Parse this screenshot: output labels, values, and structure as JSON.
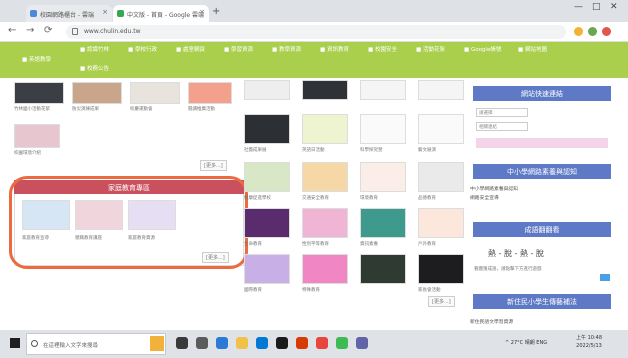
{
  "browser": {
    "tabs": [
      {
        "label": "校園網路櫃台 - 雲端",
        "close": "×"
      },
      {
        "label": "中文版 - 首頁 - Google 雲端",
        "close": "×"
      }
    ],
    "new_tab": "+",
    "window_buttons": [
      "—",
      "□",
      "✕"
    ],
    "nav": {
      "back": "←",
      "forward": "→",
      "reload": "⟳"
    },
    "url": "www.chulin.edu.tw"
  },
  "site_nav": {
    "items": [
      "■ 認識竹林",
      "■ 學校行政",
      "■ 處室網頁",
      "■ 學習資源",
      "■ 教學資源",
      "■ 資訊教育",
      "■ 校園安全",
      "■ 活動花絮",
      "■ Google帳號",
      "■ 網站地圖"
    ],
    "row2": [
      "■ 英語教學",
      "■ 校務公告"
    ]
  },
  "content": {
    "more_label": "[更多...]",
    "captions": {
      "c1": "竹林國小活動花絮",
      "c2": "防災演練成果",
      "c3": "校慶運動會",
      "c4": "閱讀推廣活動",
      "c5": "校園環境介紹",
      "c6": "社團成果展",
      "c7": "英語日活動",
      "c8": "科學探究營",
      "c9": "藝文展演",
      "c10": "健康促進學校",
      "c11": "交通安全教育",
      "c12": "環境教育",
      "c13": "品德教育",
      "c14": "生命教育",
      "c15": "性別平等教育",
      "c16": "資訊素養",
      "c17": "戶外教育",
      "c18": "國際教育",
      "c19": "特殊教育",
      "c20": "家長會活動"
    },
    "family_ed": {
      "title": "家庭教育專區",
      "items": [
        "家庭教育宣導",
        "親職教育講座",
        "家庭教育資源"
      ],
      "more": "[更多...]"
    }
  },
  "right": {
    "quick_title": "網站快速連結",
    "quick_fields": [
      "請選擇",
      "相關連結"
    ],
    "cert_title": "中小學網路素養與認知",
    "cert_links": [
      "中小學網路素養與認知",
      "網路安全宣導"
    ],
    "idiom_title": "成語翻翻看",
    "idiom_text": "熱 - 脫 - 熱 - 脫",
    "idiom_sub": "看圖猜成語，請點擊下方進行遊戲",
    "sports_title": "新住民小學生傳藝補法",
    "sports_link": "新住民語文學習資源"
  },
  "taskbar": {
    "search_placeholder": "在這裡輸入文字來搜尋",
    "sys": "^ 27°C 晴朗 ENG",
    "time": "上午 10:48",
    "date": "2022/5/13"
  }
}
